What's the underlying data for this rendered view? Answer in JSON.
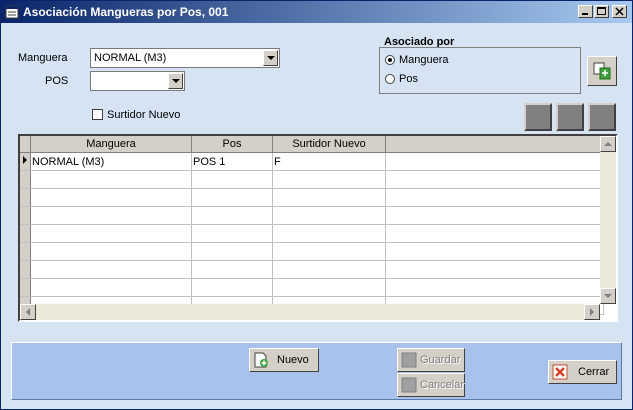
{
  "window": {
    "title": "Asociación Mangueras por Pos, 001"
  },
  "form": {
    "manguera_label": "Manguera",
    "manguera_value": "NORMAL (M3)",
    "pos_label": "POS",
    "pos_value": "",
    "surtidor_label": "Surtidor Nuevo",
    "surtidor_checked": false,
    "asociado_title": "Asociado por",
    "radio_manguera": "Manguera",
    "radio_pos": "Pos",
    "radio_selected": "Manguera"
  },
  "grid": {
    "columns": [
      "Manguera",
      "Pos",
      "Surtidor Nuevo"
    ],
    "rows": [
      {
        "manguera": "NORMAL (M3)",
        "pos": "POS 1",
        "surtidor": "F"
      }
    ]
  },
  "buttons": {
    "nuevo": "Nuevo",
    "guardar": "Guardar",
    "cancelar": "Cancelar",
    "cerrar": "Cerrar"
  },
  "colors": {
    "title_start": "#0a246a",
    "title_end": "#a6caf0",
    "background": "#d6e3f3",
    "footer": "#a7c3ec"
  }
}
